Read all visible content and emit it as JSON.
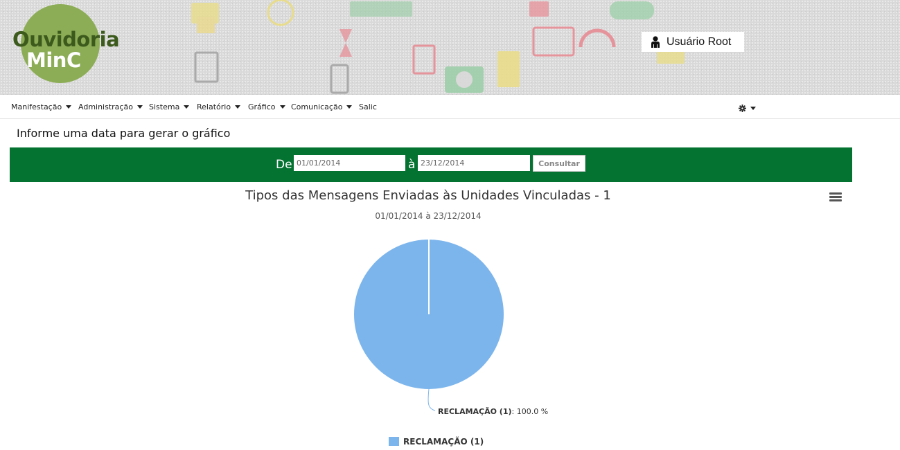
{
  "header": {
    "logo_line1": "Ouvidoria",
    "logo_line2": "MinC",
    "user_name": "Usuário Root",
    "colors": {
      "logo_green": "#8cad55",
      "logo_dark": "#3d5a1d"
    }
  },
  "nav": {
    "items": [
      {
        "label": "Manifestação",
        "dropdown": true
      },
      {
        "label": "Administração",
        "dropdown": true
      },
      {
        "label": "Sistema",
        "dropdown": true
      },
      {
        "label": "Relatório",
        "dropdown": true
      },
      {
        "label": "Gráfico",
        "dropdown": true
      },
      {
        "label": "Comunicação",
        "dropdown": true
      },
      {
        "label": "Salic",
        "dropdown": false
      }
    ],
    "settings_icon": "gear-icon"
  },
  "form": {
    "title": "Informe uma data para gerar o gráfico",
    "from_label": "De",
    "from_value": "01/01/2014",
    "to_label": "à",
    "to_value": "23/12/2014",
    "submit_label": "Consultar",
    "bar_color": "#047231"
  },
  "chart_data": {
    "type": "pie",
    "title": "Tipos das Mensagens Enviadas às Unidades Vinculadas - 1",
    "subtitle": "01/01/2014 à 23/12/2014",
    "slices": [
      {
        "name": "RECLAMAÇÃO (1)",
        "value": 100.0,
        "color": "#7cb5ec",
        "data_label_value": "100.0 %"
      }
    ],
    "legend": {
      "position": "bottom-center",
      "entries": [
        "RECLAMAÇÃO (1)"
      ]
    },
    "menu_icon": "hamburger-icon"
  }
}
